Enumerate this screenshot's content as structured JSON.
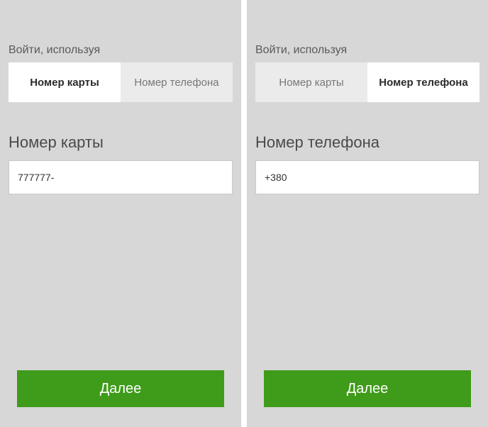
{
  "panels": [
    {
      "login_using_label": "Войти, используя",
      "tabs": {
        "card": {
          "label": "Номер карты",
          "active": true
        },
        "phone": {
          "label": "Номер телефона",
          "active": false
        }
      },
      "field_label": "Номер карты",
      "input_value": "777777-",
      "next_label": "Далее"
    },
    {
      "login_using_label": "Войти, используя",
      "tabs": {
        "card": {
          "label": "Номер карты",
          "active": false
        },
        "phone": {
          "label": "Номер телефона",
          "active": true
        }
      },
      "field_label": "Номер телефона",
      "input_value": "+380",
      "next_label": "Далее"
    }
  ]
}
